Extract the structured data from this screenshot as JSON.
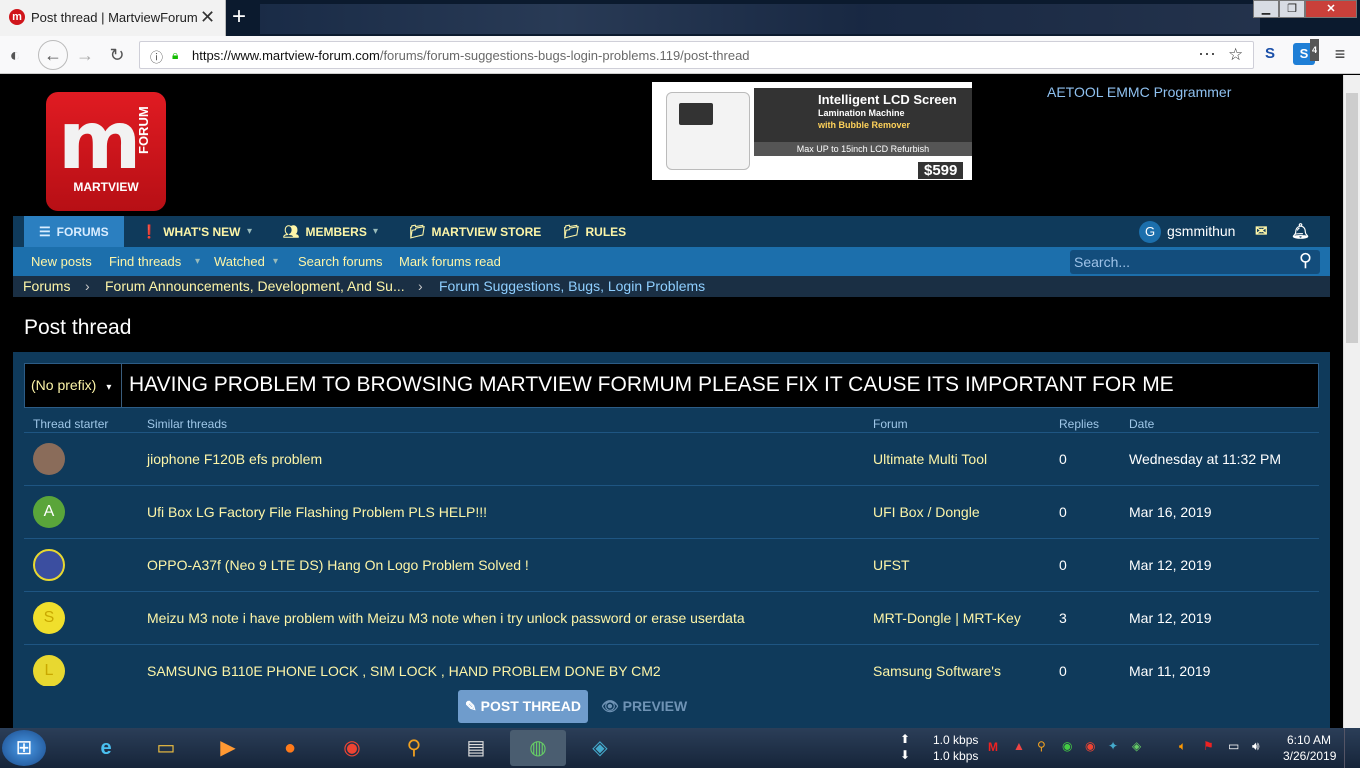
{
  "browser": {
    "tab_title": "Post thread | MartviewForum",
    "tab_close": "✕",
    "new_tab": "+",
    "url_domain": "https://www.martview-forum.com",
    "url_path": "/forums/forum-suggestions-bugs-login-problems.119/post-thread",
    "ext_badge": "4"
  },
  "header": {
    "logo_text": "MARTVIEW",
    "logo_forum": "FORUM",
    "ad_line1": "Intelligent LCD Screen",
    "ad_line2": "Lamination Machine",
    "ad_line3": "with Bubble Remover",
    "ad_line4": "Max UP to 15inch LCD Refurbish",
    "ad_price": "$599",
    "ad_link": "AETOOL EMMC Programmer"
  },
  "nav": {
    "items": [
      {
        "label": "FORUMS"
      },
      {
        "label": "WHAT'S NEW"
      },
      {
        "label": "MEMBERS"
      },
      {
        "label": "MARTVIEW STORE"
      },
      {
        "label": "RULES"
      }
    ],
    "username": "gsmmithun",
    "user_initial": "G"
  },
  "subnav": {
    "items": [
      "New posts",
      "Find threads",
      "Watched",
      "Search forums",
      "Mark forums read"
    ],
    "search_placeholder": "Search..."
  },
  "breadcrumb": [
    "Forums",
    "Forum Announcements, Development, And Su...",
    "Forum Suggestions, Bugs, Login Problems"
  ],
  "page_title": "Post thread",
  "form": {
    "prefix": "(No prefix)",
    "title_value": "HAVING PROBLEM TO BROWSING MARTVIEW FORMUM PLEASE FIX IT CAUSE ITS IMPORTANT FOR ME",
    "columns": [
      "Thread starter",
      "Similar threads",
      "Forum",
      "Replies",
      "Date"
    ],
    "rows": [
      {
        "avatar": "",
        "avatar_color": "#8a6c5a",
        "title": "jiophone F120B efs problem",
        "forum": "Ultimate Multi Tool",
        "replies": "0",
        "date": "Wednesday at 11:32 PM"
      },
      {
        "avatar": "A",
        "avatar_color": "#5aa53a",
        "title": "Ufi Box LG Factory File Flashing Problem PLS HELP!!!",
        "forum": "UFI Box / Dongle",
        "replies": "0",
        "date": "Mar 16, 2019"
      },
      {
        "avatar": "",
        "avatar_color": "#3b4ea0",
        "title": "OPPO-A37f (Neo 9 LTE DS) Hang On Logo Problem Solved !",
        "forum": "UFST",
        "replies": "0",
        "date": "Mar 12, 2019"
      },
      {
        "avatar": "S",
        "avatar_color": "#f0df2c",
        "title": "Meizu M3 note i have problem with Meizu M3 note when i try unlock password or erase userdata",
        "forum": "MRT-Dongle | MRT-Key",
        "replies": "3",
        "date": "Mar 12, 2019"
      },
      {
        "avatar": "L",
        "avatar_color": "#e8d830",
        "title": "SAMSUNG B110E PHONE LOCK , SIM LOCK , HAND PROBLEM DONE BY CM2",
        "forum": "Samsung Software's",
        "replies": "0",
        "date": "Mar 11, 2019"
      }
    ],
    "post_button": "POST THREAD",
    "preview_button": "PREVIEW"
  },
  "taskbar": {
    "net_up": "1.0 kbps",
    "net_down": "1.0 kbps",
    "time": "6:10 AM",
    "date": "3/26/2019"
  },
  "colors": {
    "accent": "#fdf5a8",
    "nav_bg": "#0f3a5b",
    "subnav_bg": "#1c6fac",
    "brand_red": "#d0151b"
  }
}
